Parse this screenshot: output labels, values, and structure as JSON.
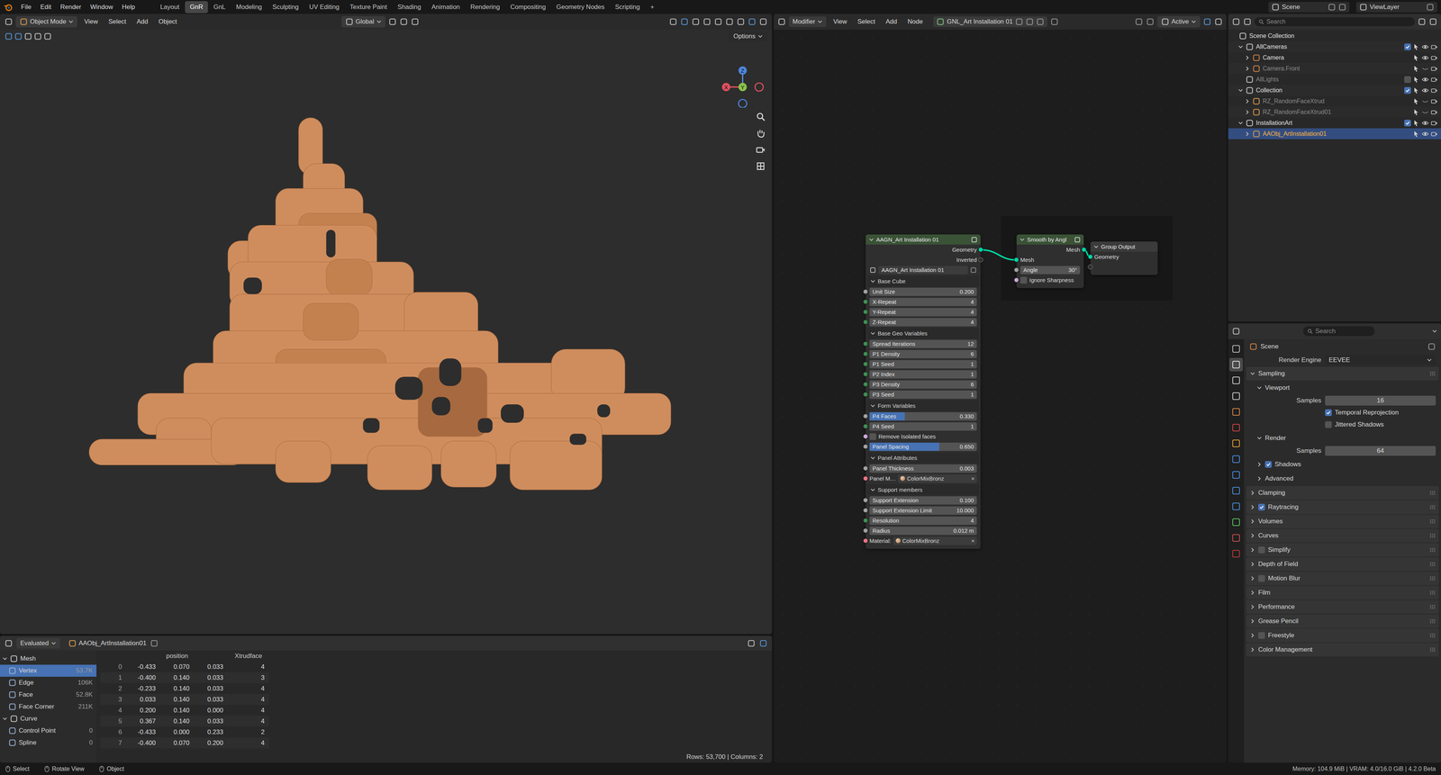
{
  "top_bar": {
    "menus": [
      "File",
      "Edit",
      "Render",
      "Window",
      "Help"
    ],
    "workspaces": [
      {
        "label": "Layout",
        "selected": false
      },
      {
        "label": "GnR",
        "selected": true
      },
      {
        "label": "GnL",
        "selected": false
      },
      {
        "label": "Modeling",
        "selected": false
      },
      {
        "label": "Sculpting",
        "selected": false
      },
      {
        "label": "UV Editing",
        "selected": false
      },
      {
        "label": "Texture Paint",
        "selected": false
      },
      {
        "label": "Shading",
        "selected": false
      },
      {
        "label": "Animation",
        "selected": false
      },
      {
        "label": "Rendering",
        "selected": false
      },
      {
        "label": "Compositing",
        "selected": false
      },
      {
        "label": "Geometry Nodes",
        "selected": false
      },
      {
        "label": "Scripting",
        "selected": false
      }
    ],
    "add_workspace": "+",
    "scene": "Scene",
    "view_layer": "ViewLayer"
  },
  "viewport": {
    "mode": "Object Mode",
    "menus": [
      "View",
      "Select",
      "Add",
      "Object"
    ],
    "orientation": "Global",
    "options": "Options",
    "gizmo": {
      "z": "Z",
      "y": "Y",
      "x": "X"
    }
  },
  "spreadsheet": {
    "mode": "Evaluated",
    "object": "AAObj_ArtInstallation01",
    "tree": [
      {
        "label": "Mesh",
        "count": "",
        "depth": 0,
        "expanded": true,
        "selected": false
      },
      {
        "label": "Vertex",
        "count": "53.7K",
        "depth": 1,
        "expanded": null,
        "selected": true
      },
      {
        "label": "Edge",
        "count": "106K",
        "depth": 1,
        "expanded": null,
        "selected": false
      },
      {
        "label": "Face",
        "count": "52.8K",
        "depth": 1,
        "expanded": null,
        "selected": false
      },
      {
        "label": "Face Corner",
        "count": "211K",
        "depth": 1,
        "expanded": null,
        "selected": false
      },
      {
        "label": "Curve",
        "count": "",
        "depth": 0,
        "expanded": true,
        "selected": false
      },
      {
        "label": "Control Point",
        "count": "0",
        "depth": 1,
        "expanded": null,
        "selected": false
      },
      {
        "label": "Spline",
        "count": "0",
        "depth": 1,
        "expanded": null,
        "selected": false
      }
    ],
    "columns": [
      "position",
      "Xtrudface"
    ],
    "rows": [
      {
        "index": "0",
        "position": [
          "-0.433",
          "0.070",
          "0.033"
        ],
        "xtrudface": "4"
      },
      {
        "index": "1",
        "position": [
          "-0.400",
          "0.140",
          "0.033"
        ],
        "xtrudface": "3"
      },
      {
        "index": "2",
        "position": [
          "-0.233",
          "0.140",
          "0.033"
        ],
        "xtrudface": "4"
      },
      {
        "index": "3",
        "position": [
          "0.033",
          "0.140",
          "0.033"
        ],
        "xtrudface": "4"
      },
      {
        "index": "4",
        "position": [
          "0.200",
          "0.140",
          "0.000"
        ],
        "xtrudface": "4"
      },
      {
        "index": "5",
        "position": [
          "0.367",
          "0.140",
          "0.033"
        ],
        "xtrudface": "4"
      },
      {
        "index": "6",
        "position": [
          "-0.433",
          "0.000",
          "0.233"
        ],
        "xtrudface": "2"
      },
      {
        "index": "7",
        "position": [
          "-0.400",
          "0.070",
          "0.200"
        ],
        "xtrudface": "4"
      }
    ],
    "footer": "Rows: 53,700 | Columns: 2"
  },
  "status_bar": {
    "items": [
      "Select",
      "Rotate View",
      "Object"
    ],
    "info": "Memory: 104.9 MiB | VRAM: 4.0/16.0 GiB | 4.2.0 Beta"
  },
  "node_editor": {
    "context": "Modifier",
    "menus": [
      "View",
      "Select",
      "Add",
      "Node"
    ],
    "node_group": "GNL_Art Installation 01",
    "pivot": "Active",
    "group_node": {
      "title": "AAGN_Art Installation 01",
      "outputs": [
        "Geometry",
        "Inverted"
      ],
      "datablock": "AAGN_Art Installation 01",
      "panels": [
        {
          "title": "Base Cube",
          "expanded": true,
          "rows": [
            {
              "kind": "field",
              "label": "Unit Size",
              "value": "0.200",
              "color": "#a1a1a1"
            },
            {
              "kind": "field",
              "label": "X-Repeat",
              "value": "4",
              "color": "#3f8f52"
            },
            {
              "kind": "field",
              "label": "Y-Repeat",
              "value": "4",
              "color": "#3f8f52"
            },
            {
              "kind": "field",
              "label": "Z-Repeat",
              "value": "4",
              "color": "#3f8f52"
            }
          ]
        },
        {
          "title": "Base Geo Variables",
          "expanded": true,
          "rows": [
            {
              "kind": "field",
              "label": "Spread Iterations",
              "value": "12",
              "color": "#3f8f52"
            },
            {
              "kind": "field",
              "label": "P1 Density",
              "value": "6",
              "color": "#3f8f52"
            },
            {
              "kind": "field",
              "label": "P1 Seed",
              "value": "1",
              "color": "#3f8f52"
            },
            {
              "kind": "field",
              "label": "P2 Index",
              "value": "1",
              "color": "#3f8f52"
            },
            {
              "kind": "field",
              "label": "P3 Density",
              "value": "6",
              "color": "#3f8f52"
            },
            {
              "kind": "field",
              "label": "P3 Seed",
              "value": "1",
              "color": "#3f8f52"
            }
          ]
        },
        {
          "title": "Form Variables",
          "expanded": true,
          "rows": [
            {
              "kind": "slider",
              "label": "P4 Faces",
              "value": "0.330",
              "level": 0.33,
              "color": "#a1a1a1"
            },
            {
              "kind": "field",
              "label": "P4 Seed",
              "value": "1",
              "color": "#3f8f52"
            },
            {
              "kind": "checkbox",
              "label": "Remove Isolated faces",
              "checked": false,
              "color": "#cca6d6"
            },
            {
              "kind": "slider",
              "label": "Panel Spacing",
              "value": "0.650",
              "level": 0.65,
              "color": "#a1a1a1"
            }
          ]
        },
        {
          "title": "Panel Attributes",
          "expanded": true,
          "rows": [
            {
              "kind": "field",
              "label": "Panel Thickness",
              "value": "0.003",
              "color": "#a1a1a1"
            },
            {
              "kind": "material",
              "label": "Panel M…",
              "value": "ColorMixBronz",
              "clear": "×",
              "color": "#eb7582"
            }
          ]
        },
        {
          "title": "Support members",
          "expanded": true,
          "rows": [
            {
              "kind": "field",
              "label": "Support Extension",
              "value": "0.100",
              "color": "#a1a1a1"
            },
            {
              "kind": "field",
              "label": "Support Extension Limit",
              "value": "10.000",
              "color": "#a1a1a1"
            },
            {
              "kind": "field",
              "label": "Resolution",
              "value": "4",
              "color": "#3f8f52"
            },
            {
              "kind": "field",
              "label": "Radius",
              "value": "0.012 m",
              "color": "#a1a1a1"
            },
            {
              "kind": "material",
              "label": "Material:",
              "value": "ColorMixBronz",
              "clear": "×",
              "color": "#eb7582"
            }
          ]
        }
      ]
    },
    "smooth_node": {
      "title": "Smooth by Angl",
      "outputs": [
        "Mesh"
      ],
      "inputs": [
        {
          "kind": "socket",
          "label": "Mesh",
          "color": "#00d6a3"
        },
        {
          "kind": "field",
          "label": "Angle",
          "value": "30°",
          "color": "#a1a1a1"
        },
        {
          "kind": "checkbox",
          "label": "Ignore Sharpness",
          "checked": false,
          "color": "#cca6d6"
        }
      ]
    },
    "output_node": {
      "title": "Group Output",
      "inputs": [
        "Geometry"
      ]
    }
  },
  "outliner": {
    "search": "Search",
    "items": [
      {
        "label": "Scene Collection",
        "depth": 0,
        "kind": "scene",
        "expanded": null,
        "selected": false,
        "greyed": false,
        "included": null,
        "visible": null
      },
      {
        "label": "AllCameras",
        "depth": 1,
        "kind": "collection",
        "expanded": true,
        "selected": false,
        "greyed": false,
        "included": true,
        "visible": true
      },
      {
        "label": "Camera",
        "depth": 2,
        "kind": "camera",
        "expanded": false,
        "selected": false,
        "greyed": false,
        "included": null,
        "visible": true
      },
      {
        "label": "Camera.Front",
        "depth": 2,
        "kind": "camera",
        "expanded": false,
        "selected": false,
        "greyed": true,
        "included": null,
        "visible": false
      },
      {
        "label": "AllLights",
        "depth": 1,
        "kind": "collection",
        "expanded": null,
        "selected": false,
        "greyed": true,
        "included": false,
        "visible": true
      },
      {
        "label": "Collection",
        "depth": 1,
        "kind": "collection",
        "expanded": true,
        "selected": false,
        "greyed": false,
        "included": true,
        "visible": true
      },
      {
        "label": "RZ_RandomFaceXtrud",
        "depth": 2,
        "kind": "object",
        "expanded": false,
        "selected": false,
        "greyed": true,
        "included": null,
        "visible": false
      },
      {
        "label": "RZ_RandomFaceXtrud01",
        "depth": 2,
        "kind": "object",
        "expanded": false,
        "selected": false,
        "greyed": true,
        "included": null,
        "visible": false
      },
      {
        "label": "InstallationArt",
        "depth": 1,
        "kind": "collection",
        "expanded": true,
        "selected": false,
        "greyed": false,
        "included": true,
        "visible": true
      },
      {
        "label": "AAObj_ArtInstallation01",
        "depth": 2,
        "kind": "object",
        "expanded": false,
        "selected": true,
        "greyed": false,
        "included": null,
        "visible": true
      }
    ]
  },
  "properties": {
    "search": "Search",
    "context": "Scene",
    "tabs": [
      {
        "selected": false,
        "color": "#bdbdbd"
      },
      {
        "selected": true,
        "color": "#e0e0e0"
      },
      {
        "selected": false,
        "color": "#d0d0d0"
      },
      {
        "selected": false,
        "color": "#d0d0d0"
      },
      {
        "selected": false,
        "color": "#d88a4a"
      },
      {
        "selected": false,
        "color": "#d04545"
      },
      {
        "selected": false,
        "color": "#e8a23c"
      },
      {
        "selected": false,
        "color": "#4a8fe0"
      },
      {
        "selected": false,
        "color": "#4a8fe0"
      },
      {
        "selected": false,
        "color": "#4a8fe0"
      },
      {
        "selected": false,
        "color": "#4a8fe0"
      },
      {
        "selected": false,
        "color": "#5cc460"
      },
      {
        "selected": false,
        "color": "#d05050"
      },
      {
        "selected": false,
        "color": "#c03a3a"
      }
    ],
    "rows": [
      {
        "kind": "select",
        "label": "Render Engine",
        "value": "EEVEE",
        "depth": 0
      },
      {
        "kind": "panel",
        "label": "Sampling",
        "depth": 0,
        "expanded": true,
        "checked": null
      },
      {
        "kind": "panel",
        "label": "Viewport",
        "depth": 1,
        "expanded": true,
        "checked": null
      },
      {
        "kind": "number",
        "label": "Samples",
        "value": "16",
        "depth": 1
      },
      {
        "kind": "check",
        "label": "Temporal Reprojection",
        "checked": true,
        "depth": 1
      },
      {
        "kind": "check",
        "label": "Jittered Shadows",
        "checked": false,
        "depth": 1
      },
      {
        "kind": "panel",
        "label": "Render",
        "depth": 1,
        "expanded": true,
        "checked": null
      },
      {
        "kind": "number",
        "label": "Samples",
        "value": "64",
        "depth": 1
      },
      {
        "kind": "panel",
        "label": "Shadows",
        "depth": 1,
        "expanded": false,
        "checked": true
      },
      {
        "kind": "panel",
        "label": "Advanced",
        "depth": 1,
        "expanded": false,
        "checked": null
      },
      {
        "kind": "panel",
        "label": "Clamping",
        "depth": 0,
        "expanded": false,
        "checked": null
      },
      {
        "kind": "panel",
        "label": "Raytracing",
        "depth": 0,
        "expanded": false,
        "checked": true
      },
      {
        "kind": "panel",
        "label": "Volumes",
        "depth": 0,
        "expanded": false,
        "checked": null
      },
      {
        "kind": "panel",
        "label": "Curves",
        "depth": 0,
        "expanded": false,
        "checked": null
      },
      {
        "kind": "panel",
        "label": "Simplify",
        "depth": 0,
        "expanded": false,
        "checked": false
      },
      {
        "kind": "panel",
        "label": "Depth of Field",
        "depth": 0,
        "expanded": false,
        "checked": null
      },
      {
        "kind": "panel",
        "label": "Motion Blur",
        "depth": 0,
        "expanded": false,
        "checked": false
      },
      {
        "kind": "panel",
        "label": "Film",
        "depth": 0,
        "expanded": false,
        "checked": null
      },
      {
        "kind": "panel",
        "label": "Performance",
        "depth": 0,
        "expanded": false,
        "checked": null
      },
      {
        "kind": "panel",
        "label": "Grease Pencil",
        "depth": 0,
        "expanded": false,
        "checked": null
      },
      {
        "kind": "panel",
        "label": "Freestyle",
        "depth": 0,
        "expanded": false,
        "checked": false
      },
      {
        "kind": "panel",
        "label": "Color Management",
        "depth": 0,
        "expanded": false,
        "checked": null
      }
    ]
  }
}
